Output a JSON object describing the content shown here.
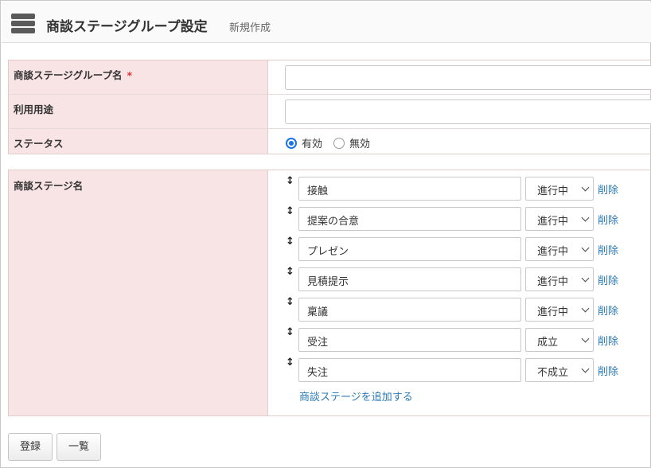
{
  "header": {
    "title": "商談ステージグループ設定",
    "subtitle": "新規作成",
    "icon": "database-icon"
  },
  "form": {
    "group_name": {
      "label": "商談ステージグループ名",
      "required_mark": "*",
      "value": ""
    },
    "usage": {
      "label": "利用用途",
      "value": ""
    },
    "status": {
      "label": "ステータス",
      "options": [
        {
          "label": "有効",
          "checked": true
        },
        {
          "label": "無効",
          "checked": false
        }
      ]
    },
    "stages": {
      "label": "商談ステージ名",
      "items": [
        {
          "name": "接触",
          "state": "進行中"
        },
        {
          "name": "提案の合意",
          "state": "進行中"
        },
        {
          "name": "プレゼン",
          "state": "進行中"
        },
        {
          "name": "見積提示",
          "state": "進行中"
        },
        {
          "name": "稟議",
          "state": "進行中"
        },
        {
          "name": "受注",
          "state": "成立"
        },
        {
          "name": "失注",
          "state": "不成立"
        }
      ],
      "delete_label": "削除",
      "add_label": "商談ステージを追加する"
    }
  },
  "actions": {
    "register_label": "登録",
    "list_label": "一覧"
  },
  "colors": {
    "label_bg": "#f8e4e4",
    "link": "#2a7ab8",
    "radio_accent": "#1a73e8",
    "required": "#dd3333"
  }
}
